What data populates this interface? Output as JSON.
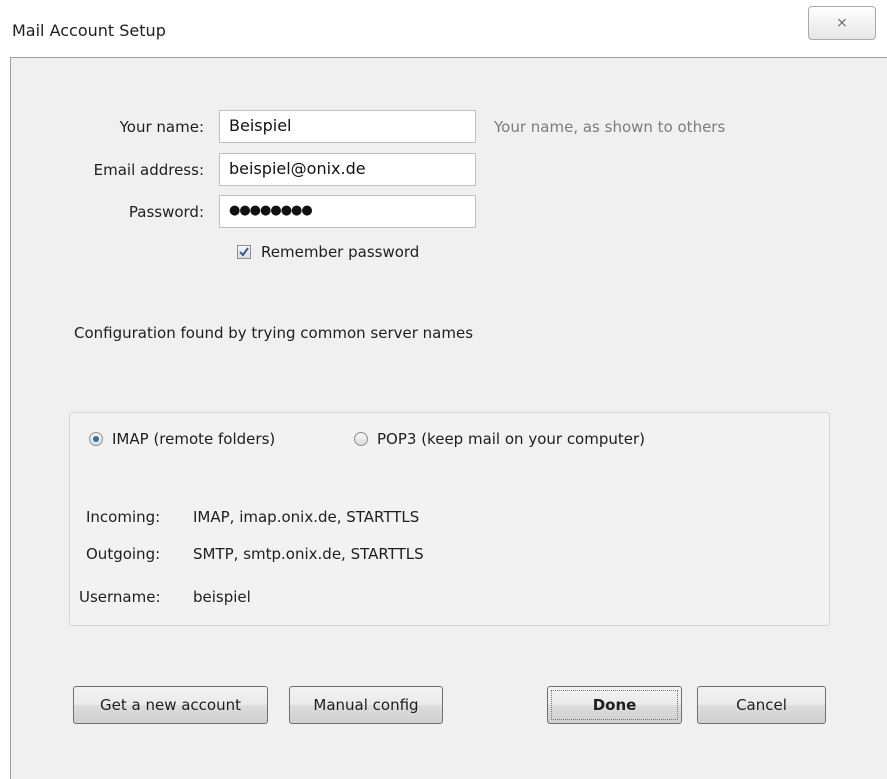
{
  "window": {
    "title": "Mail Account Setup",
    "close_glyph": "⨯"
  },
  "form": {
    "name_label": "Your name:",
    "name_value": "Beispiel",
    "name_hint": "Your name, as shown to others",
    "email_label": "Email address:",
    "email_value": "beispiel@onix.de",
    "password_label": "Password:",
    "password_value": "●●●●●●●●",
    "remember_label": "Remember password",
    "remember_checked": true
  },
  "status": {
    "message": "Configuration found by trying common server names"
  },
  "protocol": {
    "options": [
      {
        "label": "IMAP (remote folders)",
        "selected": true
      },
      {
        "label": "POP3 (keep mail on your computer)",
        "selected": false
      }
    ]
  },
  "servers": {
    "incoming_label": "Incoming:",
    "incoming_value": "IMAP, imap.onix.de, STARTTLS",
    "outgoing_label": "Outgoing:",
    "outgoing_value": "SMTP, smtp.onix.de, STARTTLS",
    "username_label": "Username:",
    "username_value": "beispiel"
  },
  "buttons": {
    "get_account": "Get a new account",
    "manual_config": "Manual config",
    "done": "Done",
    "cancel": "Cancel"
  },
  "colors": {
    "panel_bg": "#f0f0f0",
    "radio_selected": "#2e6fb6",
    "checkbox_check": "#2e5aa8"
  }
}
